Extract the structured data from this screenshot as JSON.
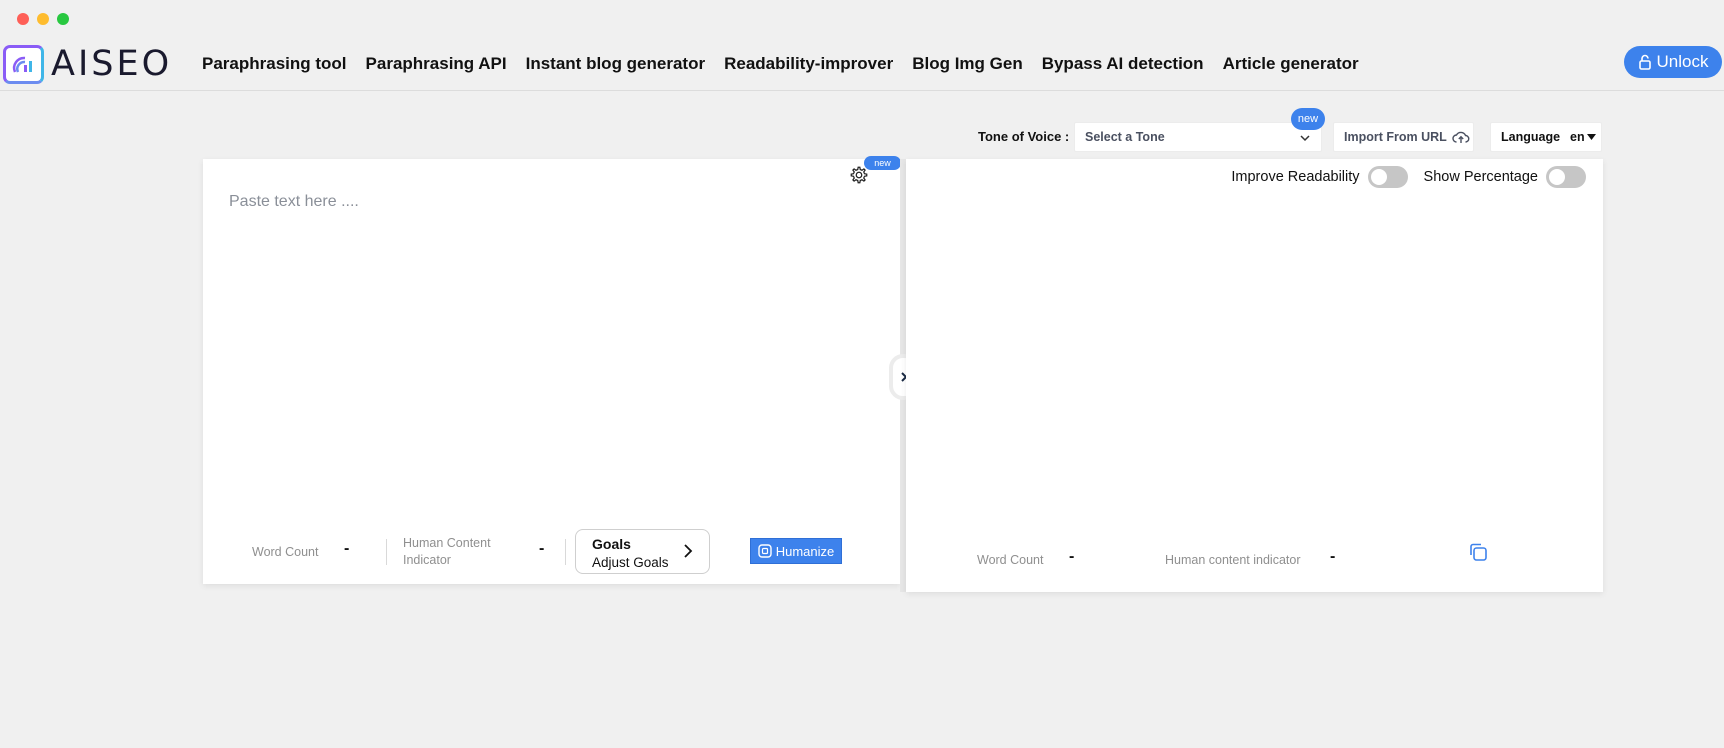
{
  "window": {
    "controls": [
      "close",
      "minimize",
      "maximize"
    ]
  },
  "brand": {
    "name": "AISEO",
    "logo_icon": "chart-logo-icon"
  },
  "nav": {
    "links": [
      "Paraphrasing tool",
      "Paraphrasing API",
      "Instant blog generator",
      "Readability-improver",
      "Blog Img Gen",
      "Bypass AI detection",
      "Article generator"
    ],
    "unlock_label": "Unlock",
    "unlock_icon": "lock-icon"
  },
  "toolbar": {
    "tone_label": "Tone of Voice :",
    "tone_placeholder": "Select a Tone",
    "tone_badge": "new",
    "import_label": "Import From URL",
    "import_icon": "cloud-upload-icon",
    "language_label": "Language",
    "language_value": "en"
  },
  "editor": {
    "placeholder": "Paste text here ....",
    "settings_icon": "gear-icon",
    "settings_badge": "new",
    "word_count_label": "Word Count",
    "word_count_value": "-",
    "human_indicator_label": "Human Content Indicator",
    "human_indicator_value": "-",
    "goals_title": "Goals",
    "goals_subtitle": "Adjust Goals",
    "humanize_label": "Humanize"
  },
  "output": {
    "improve_readability_label": "Improve Readability",
    "improve_readability_on": false,
    "show_percentage_label": "Show Percentage",
    "show_percentage_on": false,
    "word_count_label": "Word Count",
    "word_count_value": "-",
    "human_indicator_label": "Human content indicator",
    "human_indicator_value": "-",
    "copy_icon": "copy-icon"
  },
  "colors": {
    "accent": "#3d82ec",
    "background": "#f0f0f0"
  }
}
